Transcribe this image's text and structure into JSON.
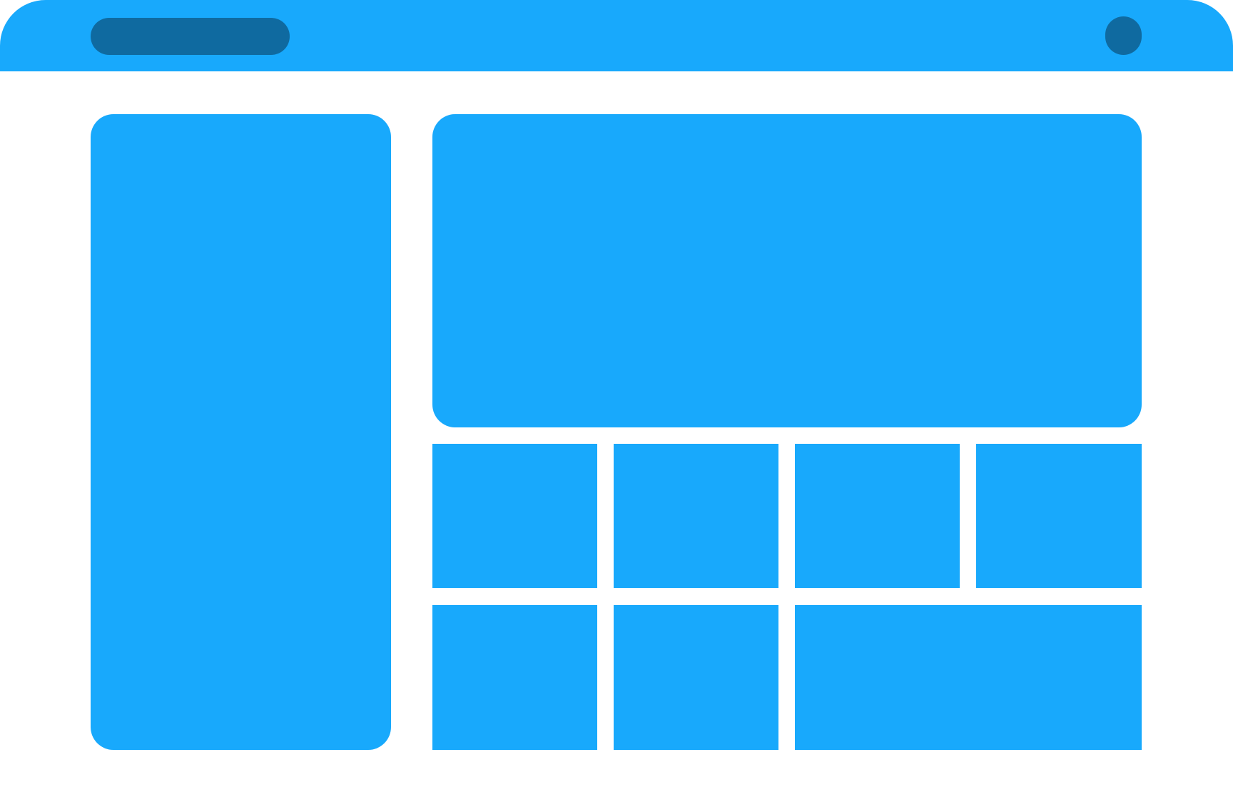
{
  "colors": {
    "primary": "#18a9fc",
    "primary_dark": "#0f6aa0",
    "background": "#ffffff"
  },
  "header": {
    "search_placeholder_icon": "search-pill",
    "avatar_icon": "avatar-circle"
  },
  "sidebar": {
    "label": ""
  },
  "hero": {
    "label": ""
  },
  "tiles": [
    {
      "label": ""
    },
    {
      "label": ""
    },
    {
      "label": ""
    },
    {
      "label": ""
    },
    {
      "label": ""
    },
    {
      "label": ""
    },
    {
      "label": ""
    }
  ]
}
